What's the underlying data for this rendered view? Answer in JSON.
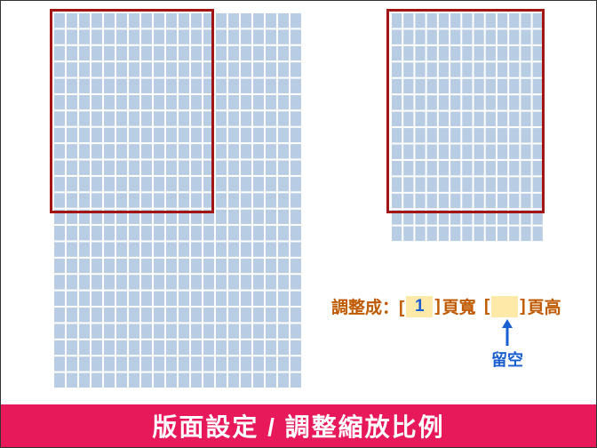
{
  "diagram": {
    "left_grid": {
      "cols": 20,
      "rows": 23
    },
    "right_grid": {
      "cols": 13,
      "rows": 14
    },
    "left_frame": "portrait page outline on left grid (top-left aligned)",
    "right_frame": "portrait page outline on right grid (approx full width)"
  },
  "formula": {
    "prefix": "調整成：[",
    "pages_wide_value": "1",
    "mid1": "]",
    "pages_wide_label": "頁寬",
    "open2": "[",
    "pages_tall_value": "",
    "close2": "]",
    "pages_tall_label": "頁高"
  },
  "annotation": {
    "blank_label": "留空"
  },
  "footer": {
    "title": "版面設定 / 調整縮放比例"
  },
  "colors": {
    "grid_fill": "#b8cde4",
    "frame_border": "#a31515",
    "formula_text": "#c05a00",
    "value_text": "#1a5fd0",
    "box_bg": "#ffe9a8",
    "footer_bg": "#e8195a"
  }
}
